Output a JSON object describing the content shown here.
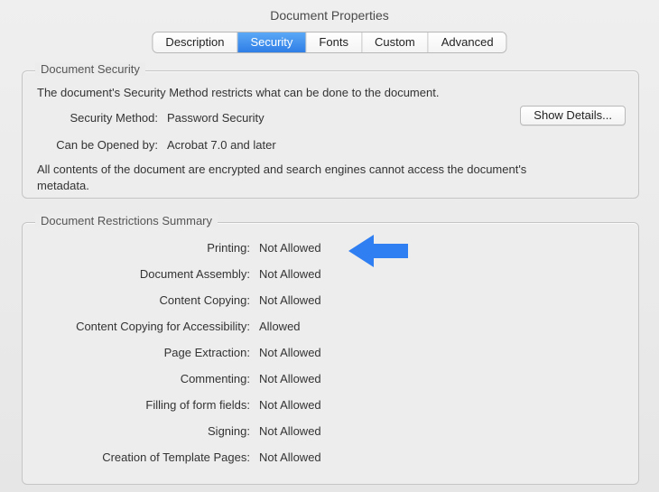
{
  "title": "Document Properties",
  "tabs": [
    {
      "label": "Description",
      "selected": false
    },
    {
      "label": "Security",
      "selected": true
    },
    {
      "label": "Fonts",
      "selected": false
    },
    {
      "label": "Custom",
      "selected": false
    },
    {
      "label": "Advanced",
      "selected": false
    }
  ],
  "security": {
    "group_label": "Document Security",
    "intro": "The document's Security Method restricts what can be done to the document.",
    "method_label": "Security Method:",
    "method_value": "Password Security",
    "opened_label": "Can be Opened by:",
    "opened_value": "Acrobat 7.0 and later",
    "details_button": "Show Details...",
    "note": "All contents of the document are encrypted and search engines cannot access the document's metadata."
  },
  "restrictions": {
    "group_label": "Document Restrictions Summary",
    "rows": [
      {
        "label": "Printing:",
        "value": "Not Allowed"
      },
      {
        "label": "Document Assembly:",
        "value": "Not Allowed"
      },
      {
        "label": "Content Copying:",
        "value": "Not Allowed"
      },
      {
        "label": "Content Copying for Accessibility:",
        "value": "Allowed"
      },
      {
        "label": "Page Extraction:",
        "value": "Not Allowed"
      },
      {
        "label": "Commenting:",
        "value": "Not Allowed"
      },
      {
        "label": "Filling of form fields:",
        "value": "Not Allowed"
      },
      {
        "label": "Signing:",
        "value": "Not Allowed"
      },
      {
        "label": "Creation of Template Pages:",
        "value": "Not Allowed"
      }
    ]
  },
  "annotation": {
    "arrow_color": "#2f7ff2"
  }
}
